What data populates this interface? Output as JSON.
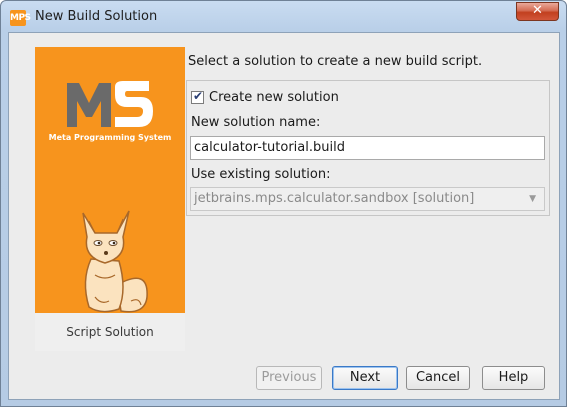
{
  "window": {
    "title": "New Build Solution",
    "app_icon_text": "MPS",
    "close_label": "✕"
  },
  "left_panel": {
    "logo_text": "MPS",
    "logo_subtitle": "Meta Programming System",
    "footer_label": "Script Solution",
    "colors": {
      "accent": "#f7941d",
      "logo": "#6a6a6a"
    }
  },
  "form": {
    "instruction": "Select a solution to create a new build script.",
    "create_new_checkbox": {
      "label": "Create new solution",
      "checked": true
    },
    "new_name_label": "New solution name:",
    "new_name_value": "calculator-tutorial.build",
    "existing_label": "Use existing solution:",
    "existing_value": "jetbrains.mps.calculator.sandbox [solution]"
  },
  "buttons": {
    "previous": "Previous",
    "next": "Next",
    "cancel": "Cancel",
    "help": "Help"
  }
}
